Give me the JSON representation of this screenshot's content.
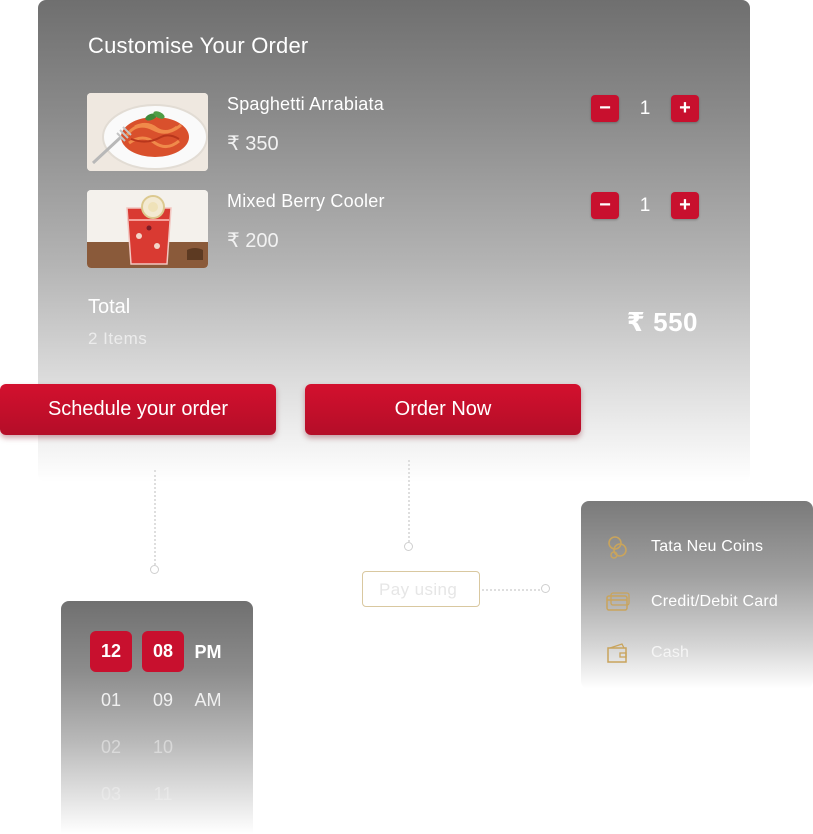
{
  "order": {
    "title": "Customise Your Order",
    "items": [
      {
        "name": "Spaghetti Arrabiata",
        "price": "₹ 350",
        "qty": "1",
        "image": "spaghetti-plate"
      },
      {
        "name": "Mixed Berry Cooler",
        "price": "₹ 200",
        "qty": "1",
        "image": "berry-drink-glass"
      }
    ],
    "total_label": "Total",
    "item_count": "2 Items",
    "total_amount": "₹ 550",
    "minus_symbol": "−",
    "plus_symbol": "+"
  },
  "actions": {
    "schedule_label": "Schedule your order",
    "order_now_label": "Order Now"
  },
  "payment": {
    "pay_using_label": "Pay using",
    "options": [
      {
        "label": "Tata Neu Coins",
        "icon": "coins-icon"
      },
      {
        "label": "Credit/Debit Card",
        "icon": "credit-card-icon"
      },
      {
        "label": "Cash",
        "icon": "wallet-icon"
      }
    ]
  },
  "time_picker": {
    "hours": [
      "12",
      "01",
      "02",
      "03"
    ],
    "minutes": [
      "08",
      "09",
      "10",
      "11"
    ],
    "periods": [
      "PM",
      "AM"
    ]
  },
  "colors": {
    "accent": "#c8102e",
    "icon_gold": "#c9a45c"
  }
}
